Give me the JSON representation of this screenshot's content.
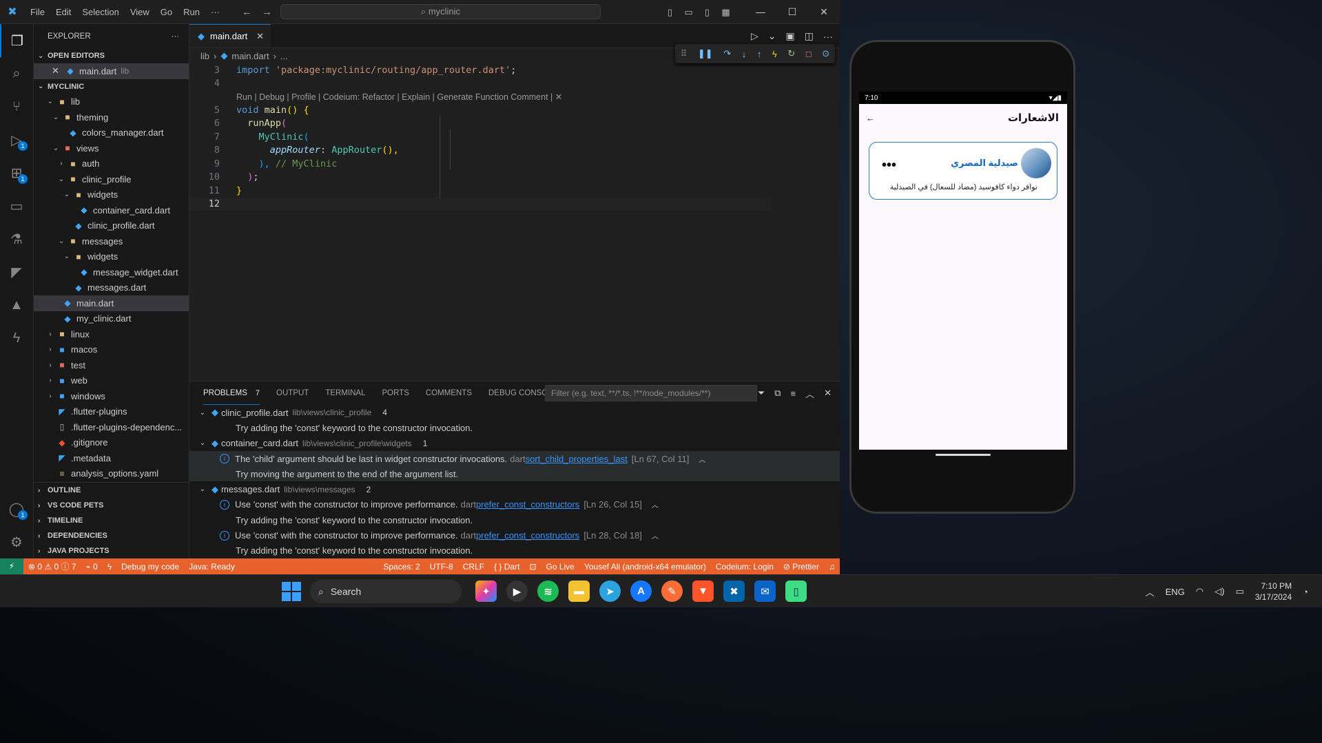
{
  "titlebar": {
    "logo": "✖",
    "menu": [
      "File",
      "Edit",
      "Selection",
      "View",
      "Go",
      "Run",
      "···"
    ],
    "search": "myclinic",
    "nav_back": "←",
    "nav_forward": "→"
  },
  "activity": {
    "badges": {
      "debug": "1",
      "extensions": "1",
      "account": "1"
    }
  },
  "sidebar": {
    "header": "EXPLORER",
    "more": "···",
    "open_editors": "OPEN EDITORS",
    "open_file": "main.dart",
    "open_file_desc": "lib",
    "project": "MYCLINIC",
    "tree": {
      "lib": "lib",
      "theming": "theming",
      "colors_manager": "colors_manager.dart",
      "views": "views",
      "auth": "auth",
      "clinic_profile": "clinic_profile",
      "widgets1": "widgets",
      "container_card": "container_card.dart",
      "clinic_profile_dart": "clinic_profile.dart",
      "messages": "messages",
      "widgets2": "widgets",
      "message_widget": "message_widget.dart",
      "messages_dart": "messages.dart",
      "main": "main.dart",
      "my_clinic": "my_clinic.dart",
      "linux": "linux",
      "macos": "macos",
      "test": "test",
      "web": "web",
      "windows": "windows",
      "flutter_plugins": ".flutter-plugins",
      "flutter_plugins_dep": ".flutter-plugins-dependenc...",
      "gitignore": ".gitignore",
      "metadata": ".metadata",
      "analysis": "analysis_options.yaml"
    },
    "sections": {
      "outline": "OUTLINE",
      "pets": "VS CODE PETS",
      "timeline": "TIMELINE",
      "deps": "DEPENDENCIES",
      "java": "JAVA PROJECTS"
    }
  },
  "editor": {
    "tab": "main.dart",
    "breadcrumb": {
      "lib": "lib",
      "file": "main.dart",
      "rest": "..."
    },
    "line_numbers": [
      "3",
      "4",
      "5",
      "6",
      "7",
      "8",
      "9",
      "10",
      "11",
      "12"
    ],
    "import_kw": "import",
    "import_str": "'package:myclinic/routing/app_router.dart'",
    "semi": ";",
    "codelens": "Run | Debug | Profile | Codeium: Refactor | Explain | Generate Function Comment | ✕",
    "void": "void",
    "main_fn": "main",
    "parens_brace": "() {",
    "runApp": "runApp",
    "open_paren": "(",
    "myclinic": "MyClinic",
    "approuter_param": "appRouter",
    "colon": ":",
    "approuter_call": "AppRouter",
    "call_parens": "(),",
    "close_paren_comma": "),",
    "comment": "// MyClinic",
    "close_paren": ")",
    "close_brace": "}"
  },
  "panel": {
    "tabs": [
      "PROBLEMS",
      "OUTPUT",
      "TERMINAL",
      "PORTS",
      "COMMENTS",
      "DEBUG CONSOLE"
    ],
    "problems_count": "7",
    "filter_placeholder": "Filter (e.g. text, **/*.ts, !**/node_modules/**)",
    "groups": [
      {
        "file": "clinic_profile.dart",
        "path": "lib\\views\\clinic_profile",
        "count": "4",
        "hint": "Try adding the 'const' keyword to the constructor invocation."
      },
      {
        "file": "container_card.dart",
        "path": "lib\\views\\clinic_profile\\widgets",
        "count": "1",
        "msg": "The 'child' argument should be last in widget constructor invocations.",
        "src": "dart",
        "rule": "sort_child_properties_last",
        "loc": "[Ln 67, Col 11]",
        "hint": "Try moving the argument to the end of the argument list."
      },
      {
        "file": "messages.dart",
        "path": "lib\\views\\messages",
        "count": "2",
        "msg1": "Use 'const' with the constructor to improve performance.",
        "src": "dart",
        "rule": "prefer_const_constructors",
        "loc1": "[Ln 26, Col 15]",
        "hint1": "Try adding the 'const' keyword to the constructor invocation.",
        "msg2": "Use 'const' with the constructor to improve performance.",
        "loc2": "[Ln 28, Col 18]",
        "hint2": "Try adding the 'const' keyword to the constructor invocation."
      }
    ]
  },
  "statusbar": {
    "remote": "⚡",
    "errors": "⊗ 0 ⚠ 0 ⓘ 7",
    "ports": "⌁ 0",
    "debug": "Debug my code",
    "java": "Java: Ready",
    "spaces": "Spaces: 2",
    "encoding": "UTF-8",
    "eol": "CRLF",
    "language": "{ } Dart",
    "golive": "Go Live",
    "device": "Yousef Ali (android-x64 emulator)",
    "codeium": "Codeium: Login",
    "prettier": "⊘ Prettier"
  },
  "taskbar": {
    "search": "Search",
    "lang": "ENG",
    "time": "7:10 PM",
    "date": "3/17/2024"
  },
  "phone": {
    "time": "7:10",
    "title": "الاشعارات",
    "back": "←",
    "card_title": "صيدلية المصري",
    "card_body": "توافر دواء  كافوسيد (مضاد للسعال) في الصيدلية",
    "more": "•••"
  }
}
